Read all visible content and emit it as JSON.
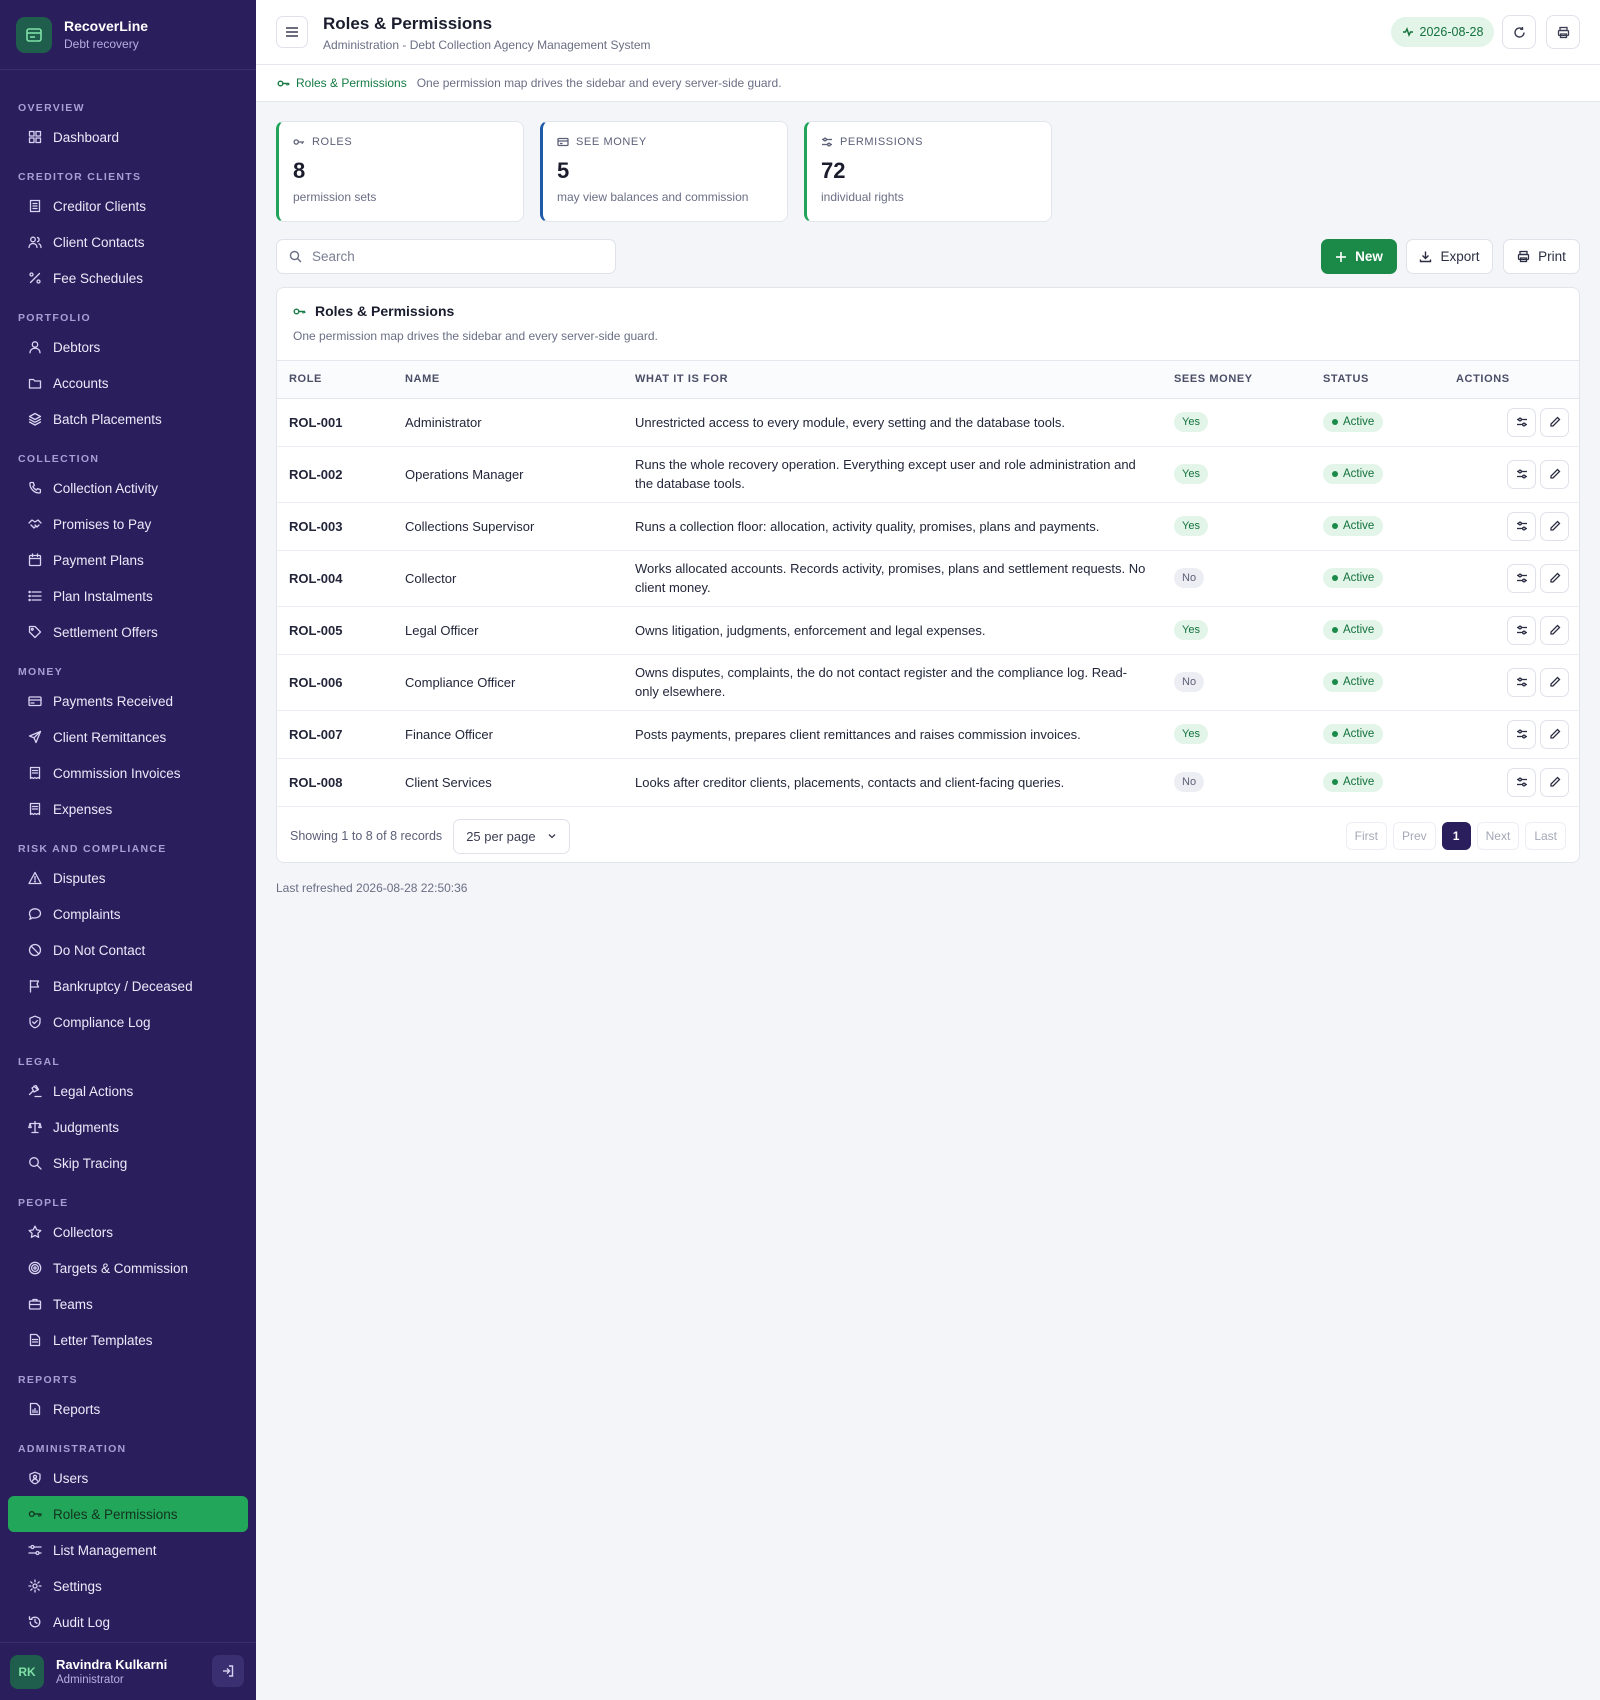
{
  "brand": {
    "name": "RecoverLine",
    "subtitle": "Debt recovery"
  },
  "sidebar": {
    "groups": [
      {
        "label": "OVERVIEW",
        "items": [
          {
            "label": "Dashboard",
            "icon": "grid-icon"
          }
        ]
      },
      {
        "label": "CREDITOR CLIENTS",
        "items": [
          {
            "label": "Creditor Clients",
            "icon": "building-icon"
          },
          {
            "label": "Client Contacts",
            "icon": "users-icon"
          },
          {
            "label": "Fee Schedules",
            "icon": "percent-icon"
          }
        ]
      },
      {
        "label": "PORTFOLIO",
        "items": [
          {
            "label": "Debtors",
            "icon": "user-icon"
          },
          {
            "label": "Accounts",
            "icon": "folder-icon"
          },
          {
            "label": "Batch Placements",
            "icon": "layers-icon"
          }
        ]
      },
      {
        "label": "COLLECTION",
        "items": [
          {
            "label": "Collection Activity",
            "icon": "phone-icon"
          },
          {
            "label": "Promises to Pay",
            "icon": "handshake-icon"
          },
          {
            "label": "Payment Plans",
            "icon": "calendar-icon"
          },
          {
            "label": "Plan Instalments",
            "icon": "list-icon"
          },
          {
            "label": "Settlement Offers",
            "icon": "tag-icon"
          }
        ]
      },
      {
        "label": "MONEY",
        "items": [
          {
            "label": "Payments Received",
            "icon": "card-icon"
          },
          {
            "label": "Client Remittances",
            "icon": "send-icon"
          },
          {
            "label": "Commission Invoices",
            "icon": "receipt-icon"
          },
          {
            "label": "Expenses",
            "icon": "receipt-icon"
          }
        ]
      },
      {
        "label": "RISK AND COMPLIANCE",
        "items": [
          {
            "label": "Disputes",
            "icon": "alert-triangle-icon"
          },
          {
            "label": "Complaints",
            "icon": "message-icon"
          },
          {
            "label": "Do Not Contact",
            "icon": "ban-icon"
          },
          {
            "label": "Bankruptcy / Deceased",
            "icon": "flag-icon"
          },
          {
            "label": "Compliance Log",
            "icon": "shield-check-icon"
          }
        ]
      },
      {
        "label": "LEGAL",
        "items": [
          {
            "label": "Legal Actions",
            "icon": "gavel-icon"
          },
          {
            "label": "Judgments",
            "icon": "scale-icon"
          },
          {
            "label": "Skip Tracing",
            "icon": "search-icon"
          }
        ]
      },
      {
        "label": "PEOPLE",
        "items": [
          {
            "label": "Collectors",
            "icon": "star-icon"
          },
          {
            "label": "Targets & Commission",
            "icon": "target-icon"
          },
          {
            "label": "Teams",
            "icon": "briefcase-icon"
          },
          {
            "label": "Letter Templates",
            "icon": "file-text-icon"
          }
        ]
      },
      {
        "label": "REPORTS",
        "items": [
          {
            "label": "Reports",
            "icon": "file-chart-icon"
          }
        ]
      },
      {
        "label": "ADMINISTRATION",
        "items": [
          {
            "label": "Users",
            "icon": "shield-user-icon"
          },
          {
            "label": "Roles & Permissions",
            "icon": "key-icon",
            "active": true
          },
          {
            "label": "List Management",
            "icon": "sliders-icon"
          },
          {
            "label": "Settings",
            "icon": "gear-icon"
          },
          {
            "label": "Audit Log",
            "icon": "history-icon"
          }
        ]
      }
    ]
  },
  "user": {
    "initials": "RK",
    "name": "Ravindra Kulkarni",
    "role": "Administrator"
  },
  "header": {
    "title": "Roles & Permissions",
    "subtitle": "Administration - Debt Collection Agency Management System",
    "date": "2026-08-28"
  },
  "crumb": {
    "label": "Roles & Permissions",
    "description": "One permission map drives the sidebar and every server-side guard."
  },
  "stats": [
    {
      "label": "ROLES",
      "value": "8",
      "sub": "permission sets",
      "icon": "key-icon"
    },
    {
      "label": "SEE MONEY",
      "value": "5",
      "sub": "may view balances and commission",
      "icon": "card-icon"
    },
    {
      "label": "PERMISSIONS",
      "value": "72",
      "sub": "individual rights",
      "icon": "sliders-icon"
    }
  ],
  "toolbar": {
    "search_placeholder": "Search",
    "new_label": "New",
    "export_label": "Export",
    "print_label": "Print"
  },
  "table": {
    "title": "Roles & Permissions",
    "description": "One permission map drives the sidebar and every server-side guard.",
    "columns": [
      "ROLE",
      "NAME",
      "WHAT IT IS FOR",
      "SEES MONEY",
      "STATUS",
      "ACTIONS"
    ],
    "rows": [
      {
        "code": "ROL-001",
        "name": "Administrator",
        "purpose": "Unrestricted access to every module, every setting and the database tools.",
        "money": "Yes",
        "status": "Active"
      },
      {
        "code": "ROL-002",
        "name": "Operations Manager",
        "purpose": "Runs the whole recovery operation. Everything except user and role administration and the database tools.",
        "money": "Yes",
        "status": "Active"
      },
      {
        "code": "ROL-003",
        "name": "Collections Supervisor",
        "purpose": "Runs a collection floor: allocation, activity quality, promises, plans and payments.",
        "money": "Yes",
        "status": "Active"
      },
      {
        "code": "ROL-004",
        "name": "Collector",
        "purpose": "Works allocated accounts. Records activity, promises, plans and settlement requests. No client money.",
        "money": "No",
        "status": "Active"
      },
      {
        "code": "ROL-005",
        "name": "Legal Officer",
        "purpose": "Owns litigation, judgments, enforcement and legal expenses.",
        "money": "Yes",
        "status": "Active"
      },
      {
        "code": "ROL-006",
        "name": "Compliance Officer",
        "purpose": "Owns disputes, complaints, the do not contact register and the compliance log. Read-only elsewhere.",
        "money": "No",
        "status": "Active"
      },
      {
        "code": "ROL-007",
        "name": "Finance Officer",
        "purpose": "Posts payments, prepares client remittances and raises commission invoices.",
        "money": "Yes",
        "status": "Active"
      },
      {
        "code": "ROL-008",
        "name": "Client Services",
        "purpose": "Looks after creditor clients, placements, contacts and client-facing queries.",
        "money": "No",
        "status": "Active"
      }
    ]
  },
  "footer": {
    "info": "Showing 1 to 8 of 8 records",
    "per_page": "25 per page",
    "pager": {
      "first": "First",
      "prev": "Prev",
      "current": "1",
      "next": "Next",
      "last": "Last"
    }
  },
  "last_refreshed": "Last refreshed 2026-08-28 22:50:36",
  "colors": {
    "sidebar": "#2a1f5c",
    "accent": "#22a65a",
    "primary_button": "#1b8a48"
  }
}
